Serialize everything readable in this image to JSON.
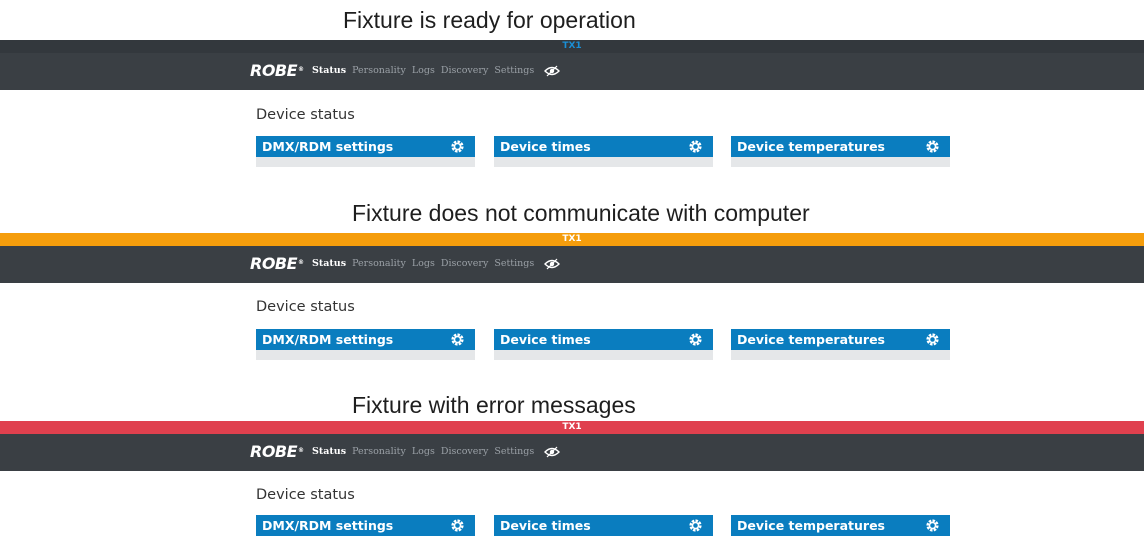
{
  "colors": {
    "ready_strip": "#33383d",
    "ready_tx": "#1a8fd6",
    "no_comm_strip": "#f59d0c",
    "error_strip": "#e0404e",
    "strip_tx_light": "#ffffff",
    "navbar": "#3a3f44",
    "panel_header": "#0a7dbf",
    "panel_body": "#e5e7e9"
  },
  "brand": {
    "logo_text": "ROBE",
    "registered_mark": "®"
  },
  "nav": {
    "items": [
      "Status",
      "Personality",
      "Logs",
      "Discovery",
      "Settings"
    ],
    "active": "Status",
    "extra_icon": "eye-icon"
  },
  "states": [
    {
      "caption": "Fixture is ready for operation",
      "strip_label": "TX1",
      "section_title": "Device status",
      "panels": [
        "DMX/RDM settings",
        "Device times",
        "Device temperatures"
      ]
    },
    {
      "caption": "Fixture does not communicate with computer",
      "strip_label": "TX1",
      "section_title": "Device status",
      "panels": [
        "DMX/RDM settings",
        "Device times",
        "Device temperatures"
      ]
    },
    {
      "caption": "Fixture with error messages",
      "strip_label": "TX1",
      "section_title": "Device status",
      "panels": [
        "DMX/RDM settings",
        "Device times",
        "Device temperatures"
      ]
    }
  ]
}
